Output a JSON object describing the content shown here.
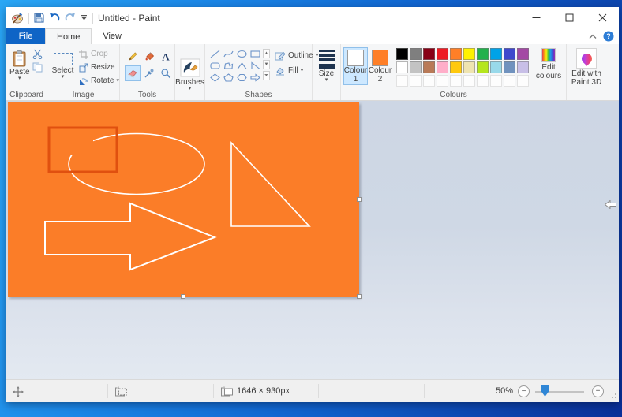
{
  "titlebar": {
    "title": "Untitled - Paint",
    "qat_icons": [
      "paint-app",
      "save",
      "undo",
      "redo",
      "customize-quick-access"
    ],
    "window_buttons": [
      "minimize",
      "maximize",
      "close"
    ]
  },
  "tabs": {
    "file": "File",
    "home": "Home",
    "view": "View"
  },
  "ribbon_right_icons": [
    "collapse-ribbon",
    "help"
  ],
  "ribbon": {
    "clipboard": {
      "group_label": "Clipboard",
      "paste": "Paste",
      "icons": [
        "clipboard-paste",
        "scissors-cut",
        "copy"
      ]
    },
    "image": {
      "group_label": "Image",
      "select": "Select",
      "crop": "Crop",
      "resize": "Resize",
      "rotate": "Rotate",
      "crop_disabled": true
    },
    "tools": {
      "group_label": "Tools",
      "items": [
        "pencil",
        "fill-with-colour",
        "text",
        "eraser",
        "colour-picker",
        "magnifier"
      ],
      "selected_tool": "eraser"
    },
    "brushes": {
      "label": "Brushes"
    },
    "shapes": {
      "group_label": "Shapes",
      "outline": "Outline",
      "fill": "Fill",
      "glyphs": [
        "line",
        "curve",
        "ellipse",
        "rectangle",
        "rounded-rectangle",
        "polygon",
        "triangle",
        "right-triangle",
        "diamond",
        "pentagon",
        "hexagon",
        "right-arrow"
      ]
    },
    "size": {
      "label": "Size"
    },
    "colours": {
      "group_label": "Colours",
      "colour1_label": "Colour 1",
      "colour1_value": "#ffffff",
      "colour1_selected": true,
      "colour2_label": "Colour 2",
      "colour2_value": "#ff7f27",
      "palette_row1": [
        "#000000",
        "#7f7f7f",
        "#880015",
        "#ed1c24",
        "#ff7f27",
        "#fff200",
        "#22b14c",
        "#00a2e8",
        "#3f48cc",
        "#a349a4"
      ],
      "palette_row2": [
        "#ffffff",
        "#c3c3c3",
        "#b97a57",
        "#ffaec9",
        "#ffc90e",
        "#efe4b0",
        "#b5e61d",
        "#99d9ea",
        "#7092be",
        "#c8bfe7"
      ],
      "palette_row3_empty_count": 10,
      "edit_colours": "Edit colours"
    },
    "paint3d": {
      "label": "Edit with Paint 3D"
    }
  },
  "canvas": {
    "fill": "#fb7d28",
    "stroke": "#ffffff",
    "rect_outline": "#e0500f",
    "drawn_shapes": [
      "rectangle-outline",
      "ellipse-outline-partially-erased",
      "right-triangle-outline",
      "right-arrow-outline"
    ]
  },
  "statusbar": {
    "canvas_size": "1646 × 930px",
    "zoom_level": "50%",
    "icons": [
      "cursor-position",
      "selection-size",
      "canvas-size",
      "zoom-out",
      "zoom-slider",
      "zoom-in"
    ]
  }
}
